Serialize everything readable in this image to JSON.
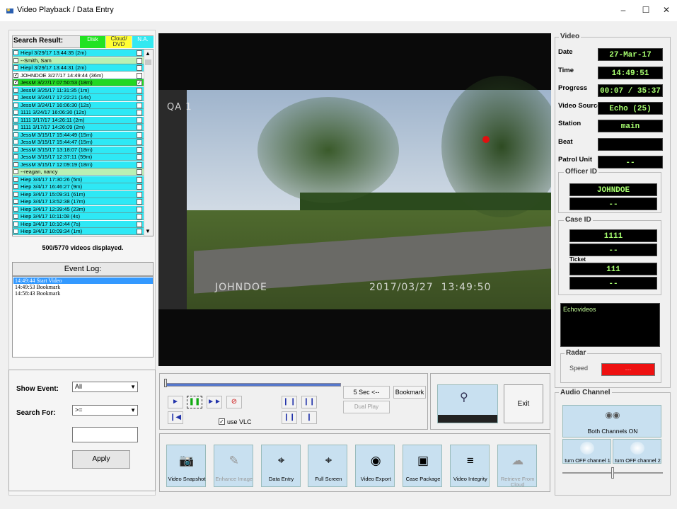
{
  "window": {
    "title": "Video Playback / Data Entry",
    "minimize_glyph": "–",
    "maximize_glyph": "☐",
    "close_glyph": "✕"
  },
  "search_result": {
    "label": "Search Result:",
    "legend": {
      "disk": "Disk",
      "cloud": "Cloud/ DVD",
      "na": "N.A."
    },
    "rows": [
      {
        "text": "Hiepl 3/29/17 13:44:35 (2m)",
        "color": "cyan",
        "left_checked": false,
        "right_checked": false
      },
      {
        "text": "--Smith, Sam",
        "color": "name",
        "left_checked": false,
        "right_checked": false
      },
      {
        "text": "Hiepl 3/29/17 13:44:31 (2m)",
        "color": "cyan",
        "left_checked": false,
        "right_checked": false
      },
      {
        "text": "JOHNDOE 3/27/17 14:49:44 (36m)",
        "color": "white",
        "left_checked": true,
        "right_checked": false
      },
      {
        "text": "JessM 3/27/17 07:50:53 (18m)",
        "color": "green",
        "left_checked": true,
        "right_checked": true
      },
      {
        "text": "JessM 3/25/17 11:31:35 (1m)",
        "color": "cyan",
        "left_checked": false,
        "right_checked": false
      },
      {
        "text": "JessM 3/24/17 17:22:21 (14s)",
        "color": "cyan",
        "left_checked": false,
        "right_checked": false
      },
      {
        "text": "JessM 3/24/17 16:06:30 (12s)",
        "color": "cyan",
        "left_checked": false,
        "right_checked": false
      },
      {
        "text": "1111 3/24/17 16:06:30 (12s)",
        "color": "cyan",
        "left_checked": false,
        "right_checked": false
      },
      {
        "text": "1111 3/17/17 14:26:11 (2m)",
        "color": "cyan",
        "left_checked": false,
        "right_checked": false
      },
      {
        "text": "1111 3/17/17 14:26:09 (2m)",
        "color": "cyan",
        "left_checked": false,
        "right_checked": false
      },
      {
        "text": "JessM 3/15/17 15:44:49 (15m)",
        "color": "cyan",
        "left_checked": false,
        "right_checked": false
      },
      {
        "text": "JessM 3/15/17 15:44:47 (15m)",
        "color": "cyan",
        "left_checked": false,
        "right_checked": false
      },
      {
        "text": "JessM 3/15/17 13:18:07 (18m)",
        "color": "cyan",
        "left_checked": false,
        "right_checked": false
      },
      {
        "text": "JessM 3/15/17 12:37:11 (59m)",
        "color": "cyan",
        "left_checked": false,
        "right_checked": false
      },
      {
        "text": "JessM 3/15/17 12:09:19 (18m)",
        "color": "cyan",
        "left_checked": false,
        "right_checked": false
      },
      {
        "text": "--reagan, nancy",
        "color": "name",
        "left_checked": false,
        "right_checked": false
      },
      {
        "text": "Hiep 3/4/17 17:30:26 (5m)",
        "color": "cyan",
        "left_checked": false,
        "right_checked": false
      },
      {
        "text": "Hiep 3/4/17 16:46:27 (9m)",
        "color": "cyan",
        "left_checked": false,
        "right_checked": false
      },
      {
        "text": "Hiep 3/4/17 15:09:31 (61m)",
        "color": "cyan",
        "left_checked": false,
        "right_checked": false
      },
      {
        "text": "Hiep 3/4/17 13:52:38 (17m)",
        "color": "cyan",
        "left_checked": false,
        "right_checked": false
      },
      {
        "text": "Hiep 3/4/17 12:39:45 (23m)",
        "color": "cyan",
        "left_checked": false,
        "right_checked": false
      },
      {
        "text": "Hiep 3/4/17 10:11:08 (4s)",
        "color": "cyan",
        "left_checked": false,
        "right_checked": false
      },
      {
        "text": "Hiep 3/4/17 10:10:44 (7s)",
        "color": "cyan",
        "left_checked": false,
        "right_checked": false
      },
      {
        "text": "Hiep 3/4/17 10:09:34 (1m)",
        "color": "cyan",
        "left_checked": false,
        "right_checked": false
      }
    ],
    "count_text": "500/5770 videos displayed."
  },
  "event_log": {
    "title": "Event Log:",
    "entries": [
      "14:49:44 Start Video",
      "14:49:53 Bookmark",
      "14:58:43 Bookmark"
    ]
  },
  "filter": {
    "show_event_label": "Show Event:",
    "show_event_value": "All",
    "search_for_label": "Search For:",
    "search_for_value": ">=",
    "search_text": "",
    "apply_label": "Apply"
  },
  "video": {
    "overlay_tl": "QA 1",
    "overlay_officer": "JOHNDOE",
    "overlay_datetime": "2017/03/27  13:49:50"
  },
  "playback": {
    "seek_fraction": 0.0,
    "five_sec_label": "5 Sec <--",
    "bookmark_label": "Bookmark",
    "dual_play_label": "Dual Play",
    "use_vlc_label": "use VLC",
    "use_vlc_checked": true,
    "exit_label": "Exit"
  },
  "tools": [
    {
      "label": "Video Snapshot",
      "icon": "camera-icon",
      "glyph": "📷",
      "enabled": true
    },
    {
      "label": "Enhance Image",
      "icon": "enhance-icon",
      "glyph": "✎",
      "enabled": false
    },
    {
      "label": "Data Entry",
      "icon": "data-entry-icon",
      "glyph": "⌖",
      "enabled": true
    },
    {
      "label": "Full Screen",
      "icon": "fullscreen-icon",
      "glyph": "⌖",
      "enabled": true
    },
    {
      "label": "Video Export",
      "icon": "disc-icon",
      "glyph": "◉",
      "enabled": true
    },
    {
      "label": "Case Package",
      "icon": "package-icon",
      "glyph": "▣",
      "enabled": true
    },
    {
      "label": "Video Integrity",
      "icon": "integrity-icon",
      "glyph": "≡",
      "enabled": true
    },
    {
      "label": "Retrieve From Cloud",
      "icon": "cloud-icon",
      "glyph": "☁",
      "enabled": false
    }
  ],
  "info": {
    "group_title": "Video",
    "date_label": "Date",
    "date_value": "27-Mar-17",
    "time_label": "Time",
    "time_value": "14:49:51",
    "progress_label": "Progress",
    "progress_value": "00:07 / 35:37",
    "source_label": "Video Source",
    "source_value": "Echo (25)",
    "station_label": "Station",
    "station_value": "main",
    "beat_label": "Beat",
    "beat_value": "",
    "patrol_label": "Patrol Unit",
    "patrol_value": "--",
    "officer_title": "Officer ID",
    "officer_1": "JOHNDOE",
    "officer_2": "--",
    "case_title": "Case ID",
    "case_1": "1111",
    "case_2": "--",
    "ticket_label": "Ticket",
    "ticket_1": "111",
    "ticket_2": "--",
    "notes_text": "Echovideos",
    "radar_title": "Radar",
    "speed_label": "Speed",
    "speed_value": "---"
  },
  "audio": {
    "title": "Audio Channel",
    "both_label": "Both Channels ON",
    "ch1_label": "turn OFF channel 1",
    "ch2_label": "turn OFF channel 2"
  },
  "colors": {
    "disk": "#22e322",
    "cloud": "#ffff33",
    "na": "#33e8f0",
    "display_bg": "#000000",
    "display_text": "#a8ff70",
    "speed_bg": "#ee1111"
  }
}
